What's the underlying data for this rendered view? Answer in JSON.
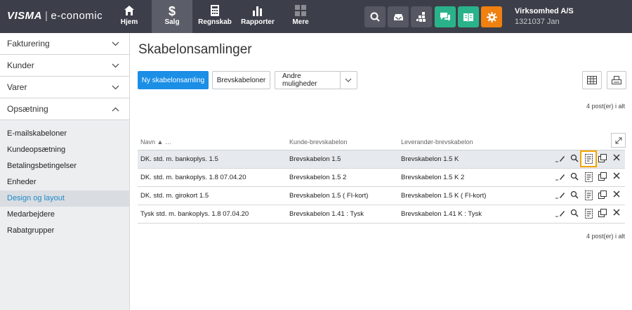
{
  "brand": {
    "logo": "VISMA",
    "product": "e-conomic"
  },
  "nav": {
    "tabs": [
      {
        "label": "Hjem",
        "icon": "home-icon"
      },
      {
        "label": "Salg",
        "icon": "dollar-icon"
      },
      {
        "label": "Regnskab",
        "icon": "calculator-icon"
      },
      {
        "label": "Rapporter",
        "icon": "bar-chart-icon"
      },
      {
        "label": "Mere",
        "icon": "grid-icon"
      }
    ],
    "active_tab": "Salg"
  },
  "company": {
    "name": "Virksomhed A/S",
    "sub": "1321037 Jan"
  },
  "sidebar": {
    "sections": [
      {
        "label": "Fakturering",
        "expanded": false
      },
      {
        "label": "Kunder",
        "expanded": false
      },
      {
        "label": "Varer",
        "expanded": false
      },
      {
        "label": "Opsætning",
        "expanded": true
      }
    ],
    "sub_items": [
      "E-mailskabeloner",
      "Kundeopsætning",
      "Betalingsbetingelser",
      "Enheder",
      "Design og layout",
      "Medarbejdere",
      "Rabatgrupper"
    ],
    "active_sub": "Design og layout"
  },
  "page": {
    "title": "Skabelonsamlinger",
    "buttons": {
      "new": "Ny skabelonsamling",
      "letter_templates": "Brevskabeloner",
      "other": "Andre muligheder"
    },
    "count_top": "4 post(er) i alt",
    "count_bottom": "4 post(er) i alt"
  },
  "table": {
    "columns": [
      "Navn",
      "…",
      "Kunde-brevskabelon",
      "Leverandør-brevskabelon"
    ],
    "rows": [
      {
        "name": "DK. std. m. bankoplys. 1.5",
        "customer": "Brevskabelon 1.5",
        "supplier": "Brevskabelon 1.5 K",
        "selected": true
      },
      {
        "name": "DK. std. m. bankoplys. 1.8 07.04.20",
        "customer": "Brevskabelon 1.5 2",
        "supplier": "Brevskabelon 1.5 K 2",
        "selected": false
      },
      {
        "name": "DK. std. m. girokort 1.5",
        "customer": "Brevskabelon 1.5 ( FI-kort)",
        "supplier": "Brevskabelon 1.5 K ( FI-kort)",
        "selected": false
      },
      {
        "name": "Tysk std. m. bankoplys. 1.8 07.04.20",
        "customer": "Brevskabelon 1.41 : Tysk",
        "supplier": "Brevskabelon 1.41 K : Tysk",
        "selected": false
      }
    ]
  },
  "colors": {
    "topbar": "#3c3f49",
    "primary": "#1b8fe6",
    "accent_green": "#2ab38b",
    "accent_orange": "#f08010",
    "highlight": "#f5a400",
    "active_link": "#1e88c8"
  }
}
